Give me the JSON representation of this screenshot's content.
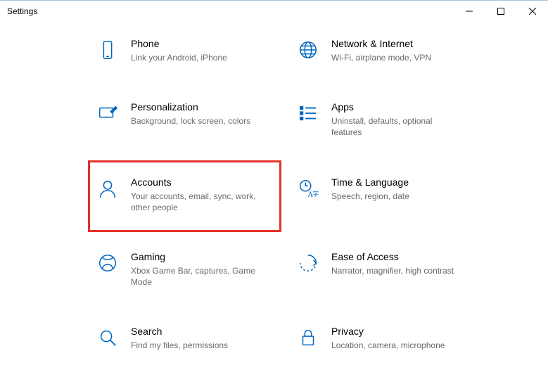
{
  "window": {
    "title": "Settings"
  },
  "tiles": {
    "phone": {
      "title": "Phone",
      "desc": "Link your Android, iPhone"
    },
    "network": {
      "title": "Network & Internet",
      "desc": "Wi-Fi, airplane mode, VPN"
    },
    "personalization": {
      "title": "Personalization",
      "desc": "Background, lock screen, colors"
    },
    "apps": {
      "title": "Apps",
      "desc": "Uninstall, defaults, optional features"
    },
    "accounts": {
      "title": "Accounts",
      "desc": "Your accounts, email, sync, work, other people"
    },
    "time": {
      "title": "Time & Language",
      "desc": "Speech, region, date"
    },
    "gaming": {
      "title": "Gaming",
      "desc": "Xbox Game Bar, captures, Game Mode"
    },
    "ease": {
      "title": "Ease of Access",
      "desc": "Narrator, magnifier, high contrast"
    },
    "search": {
      "title": "Search",
      "desc": "Find my files, permissions"
    },
    "privacy": {
      "title": "Privacy",
      "desc": "Location, camera, microphone"
    }
  }
}
